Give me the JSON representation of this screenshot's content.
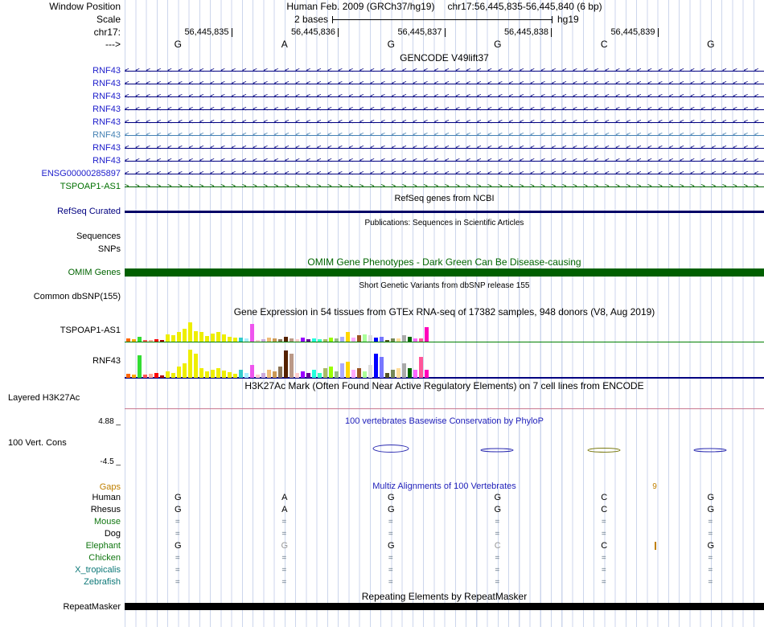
{
  "meta": {
    "window_position_label": "Window Position",
    "assembly": "Human Feb. 2009 (GRCh37/hg19)",
    "position": "chr17:56,445,835-56,445,840 (6 bp)",
    "scale_label": "Scale",
    "scale_value": "2 bases",
    "scale_genome": "hg19",
    "chrom_label": "chr17:",
    "strand_arrow": "--->",
    "coords": [
      "56,445,835",
      "56,445,836",
      "56,445,837",
      "56,445,838",
      "56,445,839"
    ],
    "bases": [
      "G",
      "A",
      "G",
      "G",
      "C",
      "G"
    ]
  },
  "gencode": {
    "title": "GENCODE V49lift37",
    "genes": [
      {
        "label": "RNF43",
        "label_color": "#2020cc",
        "color": "#000080",
        "strand": "<"
      },
      {
        "label": "RNF43",
        "label_color": "#2020cc",
        "color": "#000080",
        "strand": "<"
      },
      {
        "label": "RNF43",
        "label_color": "#2020cc",
        "color": "#000080",
        "strand": "<"
      },
      {
        "label": "RNF43",
        "label_color": "#2020cc",
        "color": "#000080",
        "strand": "<"
      },
      {
        "label": "RNF43",
        "label_color": "#2020cc",
        "color": "#000080",
        "strand": "<"
      },
      {
        "label": "RNF43",
        "label_color": "#4682b4",
        "color": "#4682b4",
        "strand": "<"
      },
      {
        "label": "RNF43",
        "label_color": "#2020cc",
        "color": "#000080",
        "strand": "<"
      },
      {
        "label": "RNF43",
        "label_color": "#2020cc",
        "color": "#000080",
        "strand": "<"
      },
      {
        "label": "ENSG00000285897",
        "label_color": "#2020cc",
        "color": "#000080",
        "strand": "<"
      },
      {
        "label": "TSPOAP1-AS1",
        "label_color": "#007000",
        "color": "#006400",
        "strand": ">"
      }
    ]
  },
  "refseq": {
    "title": "RefSeq genes from NCBI",
    "label": "RefSeq Curated",
    "label_color": "#000080",
    "bar_color": "#000066"
  },
  "publications": {
    "title": "Publications: Sequences in Scientific Articles",
    "rows": [
      "Sequences",
      "SNPs"
    ]
  },
  "omim": {
    "title": "OMIM Gene Phenotypes - Dark Green Can Be Disease-causing",
    "label": "OMIM Genes",
    "color": "#006400",
    "bar_color": "#005f00"
  },
  "dbsnp": {
    "title": "Short Genetic Variants from dbSNP release 155",
    "label": "Common dbSNP(155)"
  },
  "gtex": {
    "title": "Gene Expression in 54 tissues from GTEx RNA-seq of 17382 samples, 948 donors (V8, Aug 2019)",
    "tracks": [
      {
        "label": "TSPOAP1-AS1",
        "baseline_color": "#008000",
        "bars": [
          {
            "c": "#FF6600",
            "h": 4
          },
          {
            "c": "#FFAA00",
            "h": 3
          },
          {
            "c": "#33DD33",
            "h": 6
          },
          {
            "c": "#FF5555",
            "h": 2
          },
          {
            "c": "#FFAA99",
            "h": 2
          },
          {
            "c": "#FF0000",
            "h": 3
          },
          {
            "c": "#AA0000",
            "h": 2
          },
          {
            "c": "#EEEE00",
            "h": 9
          },
          {
            "c": "#EEEE00",
            "h": 8
          },
          {
            "c": "#EEEE00",
            "h": 12
          },
          {
            "c": "#EEEE00",
            "h": 16
          },
          {
            "c": "#EEEE00",
            "h": 24
          },
          {
            "c": "#EEEE00",
            "h": 13
          },
          {
            "c": "#EEEE00",
            "h": 12
          },
          {
            "c": "#EEEE00",
            "h": 7
          },
          {
            "c": "#EEEE00",
            "h": 10
          },
          {
            "c": "#EEEE00",
            "h": 12
          },
          {
            "c": "#EEEE00",
            "h": 9
          },
          {
            "c": "#EEEE00",
            "h": 6
          },
          {
            "c": "#EEEE00",
            "h": 5
          },
          {
            "c": "#33CCCC",
            "h": 5
          },
          {
            "c": "#AAEEFF",
            "h": 4
          },
          {
            "c": "#EE55EE",
            "h": 22
          },
          {
            "c": "#FFCCCC",
            "h": 2
          },
          {
            "c": "#CCAADD",
            "h": 3
          },
          {
            "c": "#EEBB77",
            "h": 5
          },
          {
            "c": "#CC9955",
            "h": 4
          },
          {
            "c": "#8B7355",
            "h": 3
          },
          {
            "c": "#552200",
            "h": 6
          },
          {
            "c": "#BB9988",
            "h": 4
          },
          {
            "c": "#FFCCCC",
            "h": 3
          },
          {
            "c": "#9900FF",
            "h": 5
          },
          {
            "c": "#660099",
            "h": 3
          },
          {
            "c": "#22FFDD",
            "h": 4
          },
          {
            "c": "#33FFC2",
            "h": 3
          },
          {
            "c": "#AABB66",
            "h": 3
          },
          {
            "c": "#99FF00",
            "h": 5
          },
          {
            "c": "#99BB88",
            "h": 4
          },
          {
            "c": "#AAAAFF",
            "h": 6
          },
          {
            "c": "#FFD700",
            "h": 12
          },
          {
            "c": "#FFAAFF",
            "h": 5
          },
          {
            "c": "#995522",
            "h": 8
          },
          {
            "c": "#AAFF99",
            "h": 9
          },
          {
            "c": "#DDDDDD",
            "h": 8
          },
          {
            "c": "#0000FF",
            "h": 5
          },
          {
            "c": "#7777FF",
            "h": 6
          },
          {
            "c": "#555522",
            "h": 2
          },
          {
            "c": "#778855",
            "h": 4
          },
          {
            "c": "#FFDD99",
            "h": 4
          },
          {
            "c": "#AAAAAA",
            "h": 8
          },
          {
            "c": "#006600",
            "h": 6
          },
          {
            "c": "#FF66FF",
            "h": 4
          },
          {
            "c": "#FF5599",
            "h": 4
          },
          {
            "c": "#FF00BB",
            "h": 18
          }
        ]
      },
      {
        "label": "RNF43",
        "baseline_color": "#000080",
        "bars": [
          {
            "c": "#FF6600",
            "h": 5
          },
          {
            "c": "#FFAA00",
            "h": 4
          },
          {
            "c": "#33DD33",
            "h": 28
          },
          {
            "c": "#FF5555",
            "h": 4
          },
          {
            "c": "#FFAA99",
            "h": 5
          },
          {
            "c": "#FF0000",
            "h": 6
          },
          {
            "c": "#AA0000",
            "h": 3
          },
          {
            "c": "#EEEE00",
            "h": 8
          },
          {
            "c": "#EEEE00",
            "h": 6
          },
          {
            "c": "#EEEE00",
            "h": 14
          },
          {
            "c": "#EEEE00",
            "h": 18
          },
          {
            "c": "#EEEE00",
            "h": 35
          },
          {
            "c": "#EEEE00",
            "h": 30
          },
          {
            "c": "#EEEE00",
            "h": 12
          },
          {
            "c": "#EEEE00",
            "h": 8
          },
          {
            "c": "#EEEE00",
            "h": 10
          },
          {
            "c": "#EEEE00",
            "h": 12
          },
          {
            "c": "#EEEE00",
            "h": 9
          },
          {
            "c": "#EEEE00",
            "h": 7
          },
          {
            "c": "#EEEE00",
            "h": 5
          },
          {
            "c": "#33CCCC",
            "h": 10
          },
          {
            "c": "#AAEEFF",
            "h": 6
          },
          {
            "c": "#EE55EE",
            "h": 16
          },
          {
            "c": "#FFCCCC",
            "h": 4
          },
          {
            "c": "#CCAADD",
            "h": 6
          },
          {
            "c": "#EEBB77",
            "h": 10
          },
          {
            "c": "#CC9955",
            "h": 8
          },
          {
            "c": "#8B7355",
            "h": 14
          },
          {
            "c": "#552200",
            "h": 34
          },
          {
            "c": "#BB9988",
            "h": 30
          },
          {
            "c": "#FFCCCC",
            "h": 6
          },
          {
            "c": "#9900FF",
            "h": 8
          },
          {
            "c": "#660099",
            "h": 6
          },
          {
            "c": "#22FFDD",
            "h": 10
          },
          {
            "c": "#33FFC2",
            "h": 6
          },
          {
            "c": "#AABB66",
            "h": 12
          },
          {
            "c": "#99FF00",
            "h": 14
          },
          {
            "c": "#99BB88",
            "h": 8
          },
          {
            "c": "#AAAAFF",
            "h": 18
          },
          {
            "c": "#FFD700",
            "h": 20
          },
          {
            "c": "#FFAAFF",
            "h": 10
          },
          {
            "c": "#995522",
            "h": 12
          },
          {
            "c": "#AAFF99",
            "h": 8
          },
          {
            "c": "#DDDDDD",
            "h": 16
          },
          {
            "c": "#0000FF",
            "h": 30
          },
          {
            "c": "#7777FF",
            "h": 26
          },
          {
            "c": "#555522",
            "h": 6
          },
          {
            "c": "#778855",
            "h": 10
          },
          {
            "c": "#FFDD99",
            "h": 12
          },
          {
            "c": "#AAAAAA",
            "h": 18
          },
          {
            "c": "#006600",
            "h": 12
          },
          {
            "c": "#FF66FF",
            "h": 10
          },
          {
            "c": "#FF5599",
            "h": 26
          },
          {
            "c": "#FF00BB",
            "h": 10
          }
        ]
      }
    ]
  },
  "h3k27ac": {
    "title": "H3K27Ac Mark (Often Found Near Active Regulatory Elements) on 7 cell lines from ENCODE",
    "label": "Layered H3K27Ac",
    "line_color": "#c87890"
  },
  "phylop": {
    "title": "100 vertebrates Basewise Conservation by PhyloP",
    "title_color": "#2222bb",
    "label": "100 Vert. Cons",
    "max_label": "4.88 _",
    "min_label": "-4.5 _"
  },
  "align": {
    "title": "Multiz Alignments of 100 Vertebrates",
    "title_color": "#2222bb",
    "gaps_label": "Gaps",
    "gap_size": "9",
    "gap_color": "#c08000",
    "rows": [
      {
        "label": "Human",
        "color": "#000000",
        "cells": [
          {
            "t": "G"
          },
          {
            "t": "A"
          },
          {
            "t": "G"
          },
          {
            "t": "G"
          },
          {
            "t": "C"
          },
          {
            "t": "G"
          }
        ]
      },
      {
        "label": "Rhesus",
        "color": "#000000",
        "cells": [
          {
            "t": "G"
          },
          {
            "t": "A"
          },
          {
            "t": "G"
          },
          {
            "t": "G"
          },
          {
            "t": "C"
          },
          {
            "t": "G"
          }
        ]
      },
      {
        "label": "Mouse",
        "color": "#117711",
        "cells": [
          {
            "t": "="
          },
          {
            "t": "="
          },
          {
            "t": "="
          },
          {
            "t": "="
          },
          {
            "t": "="
          },
          {
            "t": "="
          }
        ]
      },
      {
        "label": "Dog",
        "color": "#000000",
        "cells": [
          {
            "t": "="
          },
          {
            "t": "="
          },
          {
            "t": "="
          },
          {
            "t": "="
          },
          {
            "t": "="
          },
          {
            "t": "="
          }
        ]
      },
      {
        "label": "Elephant",
        "color": "#117711",
        "cells": [
          {
            "t": "G"
          },
          {
            "t": "G",
            "c": "#999999"
          },
          {
            "t": "G"
          },
          {
            "t": "C",
            "c": "#999999"
          },
          {
            "t": "C"
          },
          {
            "t": "G"
          }
        ]
      },
      {
        "label": "Chicken",
        "color": "#117711",
        "cells": [
          {
            "t": "="
          },
          {
            "t": "="
          },
          {
            "t": "="
          },
          {
            "t": "="
          },
          {
            "t": "="
          },
          {
            "t": "="
          }
        ]
      },
      {
        "label": "X_tropicalis",
        "color": "#0d7878",
        "cells": [
          {
            "t": "="
          },
          {
            "t": "="
          },
          {
            "t": "="
          },
          {
            "t": "="
          },
          {
            "t": "="
          },
          {
            "t": "="
          }
        ]
      },
      {
        "label": "Zebrafish",
        "color": "#0d7878",
        "cells": [
          {
            "t": "="
          },
          {
            "t": "="
          },
          {
            "t": "="
          },
          {
            "t": "="
          },
          {
            "t": "="
          },
          {
            "t": "="
          }
        ]
      }
    ]
  },
  "repeatmasker": {
    "title": "Repeating Elements by RepeatMasker",
    "label": "RepeatMasker",
    "bar_color": "#000000"
  }
}
